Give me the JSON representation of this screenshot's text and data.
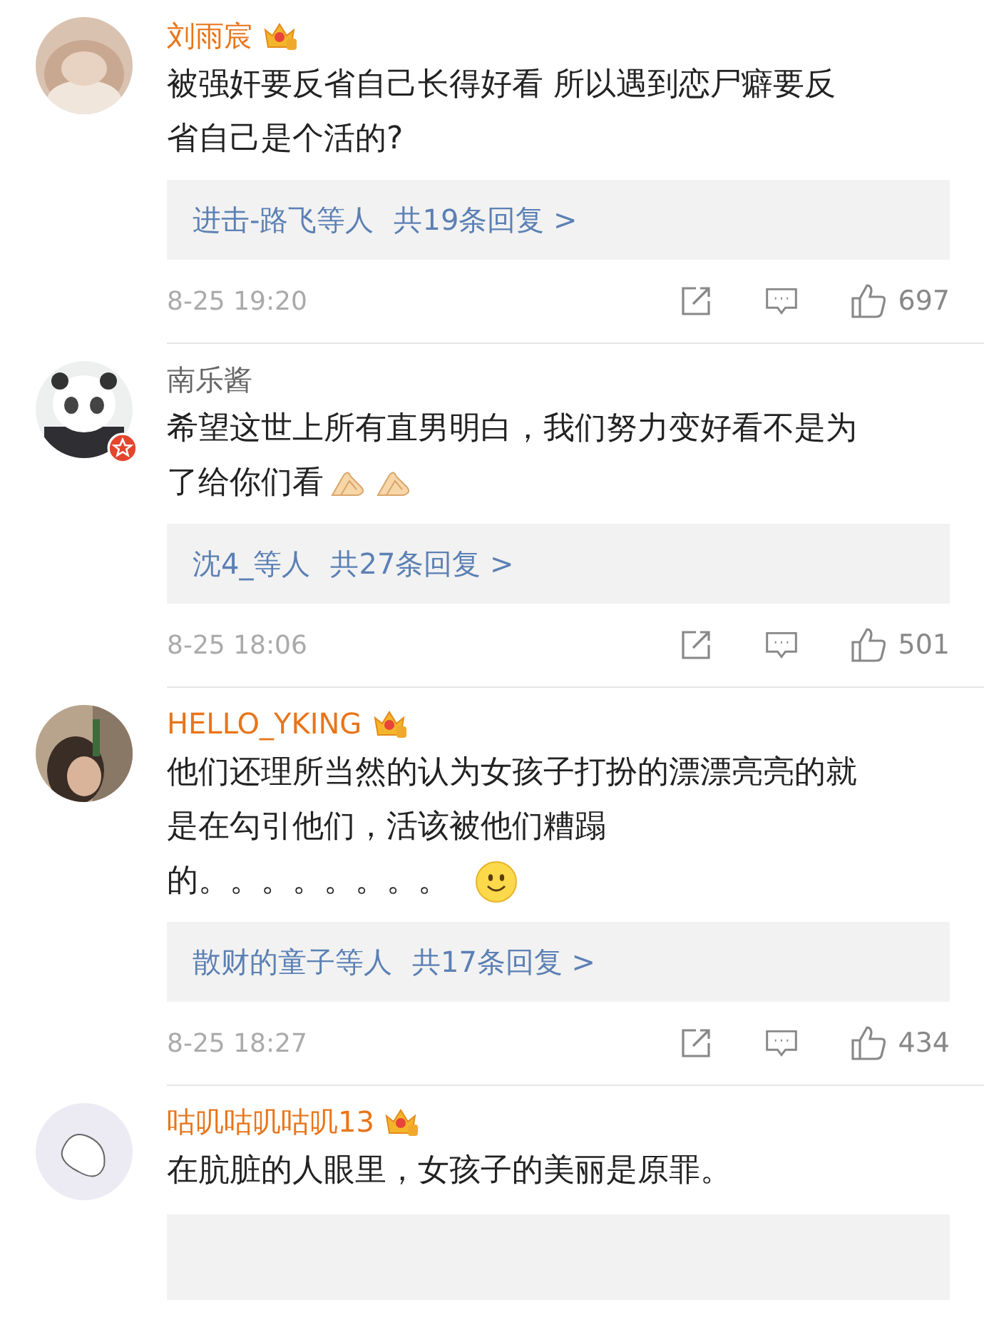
{
  "comments": [
    {
      "name": "刘雨宸",
      "vip": true,
      "lines": [
        "被强奸要反省自己长得好看 所以遇到恋尸癖要反",
        "省自己是个活的?"
      ],
      "replies": {
        "users": "进击-路飞等人",
        "count": "共19条回复 >"
      },
      "time": "8-25 19:20",
      "likes": "697"
    },
    {
      "name": "南乐酱",
      "vip": false,
      "verified": true,
      "lines": [
        "希望这世上所有直男明白，我们努力变好看不是为",
        "了给你们看"
      ],
      "emojis": [
        {
          "kind": "hands"
        },
        {
          "kind": "hands"
        }
      ],
      "replies": {
        "users": "沈4_等人",
        "count": "共27条回复 >"
      },
      "time": "8-25 18:06",
      "likes": "501"
    },
    {
      "name": "HELLO_YKING",
      "vip": true,
      "lines": [
        "他们还理所当然的认为女孩子打扮的漂漂亮亮的就",
        "是在勾引他们，活该被他们糟蹋",
        "的。。。。。。。。"
      ],
      "emojis": [
        {
          "kind": "smile"
        }
      ],
      "replies": {
        "users": "散财的童子等人",
        "count": "共17条回复 >"
      },
      "time": "8-25 18:27",
      "likes": "434"
    },
    {
      "name": "咕叽咕叽咕叽13",
      "vip": true,
      "lines": [
        "在肮脏的人眼里，女孩子的美丽是原罪。"
      ],
      "replies_cut": true
    }
  ]
}
